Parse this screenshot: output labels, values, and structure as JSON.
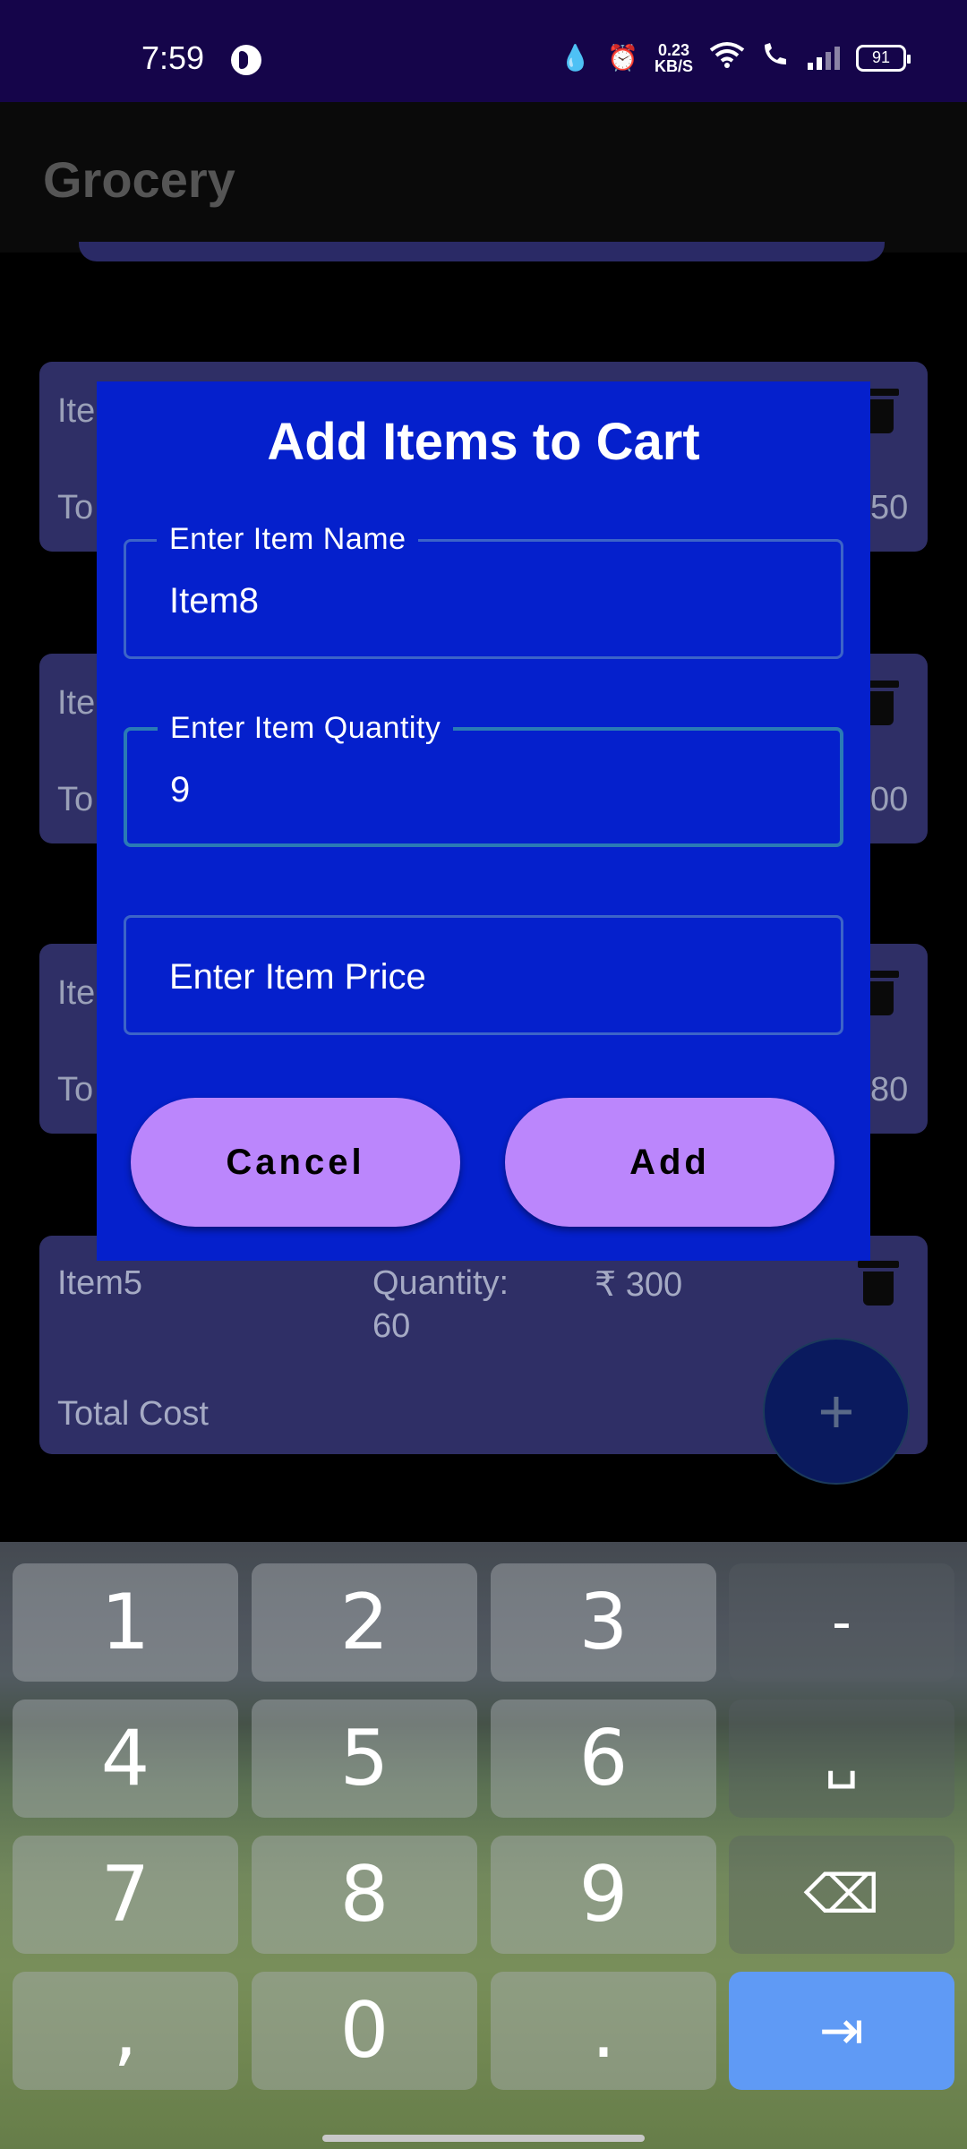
{
  "status_bar": {
    "time": "7:59",
    "speed_value": "0.23",
    "speed_unit": "KB/S",
    "battery": "91"
  },
  "app_bar": {
    "title": "Grocery"
  },
  "list": {
    "cards": [
      {
        "name_partial": "Ite",
        "total_partial": "To",
        "price_partial": "50"
      },
      {
        "name_partial": "Ite",
        "total_partial": "To",
        "price_partial": "00"
      },
      {
        "name_partial": "Ite",
        "total_partial": "To",
        "price_partial": "80"
      }
    ],
    "item5": {
      "name": "Item5",
      "quantity_label": "Quantity:",
      "quantity_value": "60",
      "price": "₹ 300",
      "total_label": "Total Cost"
    }
  },
  "fab": {
    "icon": "plus-icon",
    "glyph": "+"
  },
  "dialog": {
    "title": "Add Items to Cart",
    "name_field": {
      "label": "Enter Item Name",
      "value": "Item8"
    },
    "quantity_field": {
      "label": "Enter Item Quantity",
      "value": "9"
    },
    "price_field": {
      "placeholder": "Enter Item Price"
    },
    "cancel_label": "Cancel",
    "add_label": "Add"
  },
  "keyboard": {
    "keys": [
      "1",
      "2",
      "3",
      "-",
      "4",
      "5",
      "6",
      "␣",
      "7",
      "8",
      "9",
      "⌫",
      ",",
      "0",
      ".",
      "⇥"
    ]
  },
  "colors": {
    "status_bar": "#15054a",
    "dialog": "#0520cc",
    "button": "#bb86fc",
    "card": "#2f2f66",
    "enter_key": "#5f9af5"
  }
}
